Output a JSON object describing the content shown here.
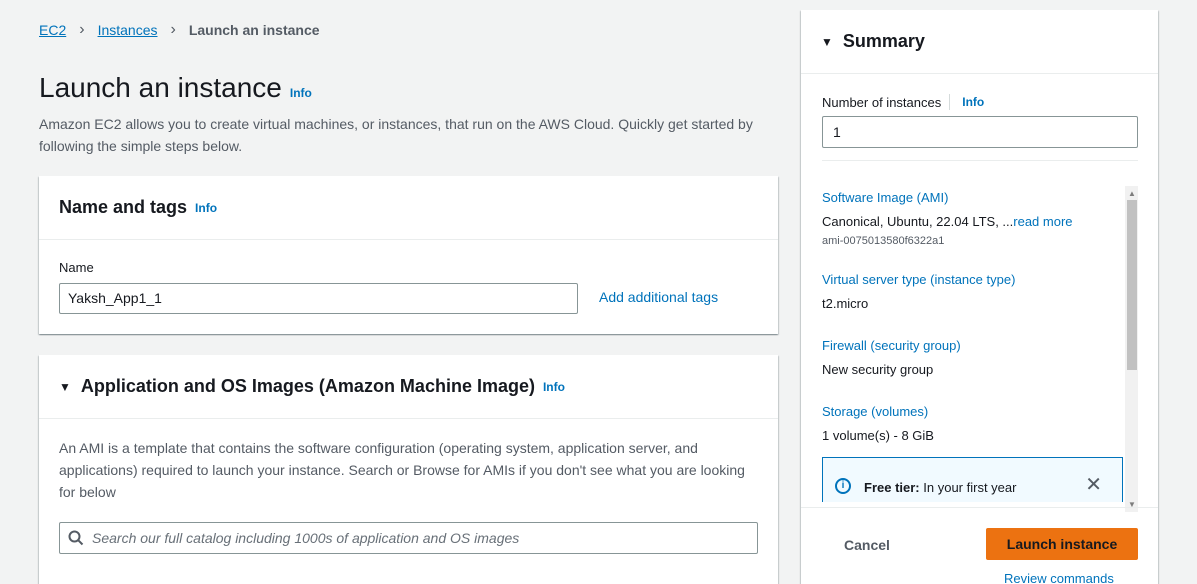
{
  "breadcrumb": {
    "items": [
      "EC2",
      "Instances"
    ],
    "current": "Launch an instance"
  },
  "page": {
    "title": "Launch an instance",
    "info": "Info",
    "description": "Amazon EC2 allows you to create virtual machines, or instances, that run on the AWS Cloud. Quickly get started by following the simple steps below."
  },
  "name_tags": {
    "title": "Name and tags",
    "info": "Info",
    "name_label": "Name",
    "name_value": "Yaksh_App1_1",
    "add_tags": "Add additional tags"
  },
  "ami": {
    "title": "Application and OS Images (Amazon Machine Image)",
    "info": "Info",
    "description": "An AMI is a template that contains the software configuration (operating system, application server, and applications) required to launch your instance. Search or Browse for AMIs if you don't see what you are looking for below",
    "search_placeholder": "Search our full catalog including 1000s of application and OS images",
    "search_icon": "search-icon"
  },
  "summary": {
    "title": "Summary",
    "num_instances_label": "Number of instances",
    "info": "Info",
    "num_instances_value": "1",
    "items": [
      {
        "label": "Software Image (AMI)",
        "value": "Canonical, Ubuntu, 22.04 LTS, ...",
        "value_link": "read more",
        "sub": "ami-0075013580f6322a1"
      },
      {
        "label": "Virtual server type (instance type)",
        "value": "t2.micro"
      },
      {
        "label": "Firewall (security group)",
        "value": "New security group"
      },
      {
        "label": "Storage (volumes)",
        "value": "1 volume(s) - 8 GiB"
      }
    ],
    "free_tier": {
      "title": "Free tier:",
      "text": "In your first year"
    },
    "cancel": "Cancel",
    "launch": "Launch instance",
    "review": "Review commands"
  },
  "colors": {
    "link": "#0073bb",
    "primary_button": "#ec7211",
    "page_background": "#f2f3f3"
  }
}
